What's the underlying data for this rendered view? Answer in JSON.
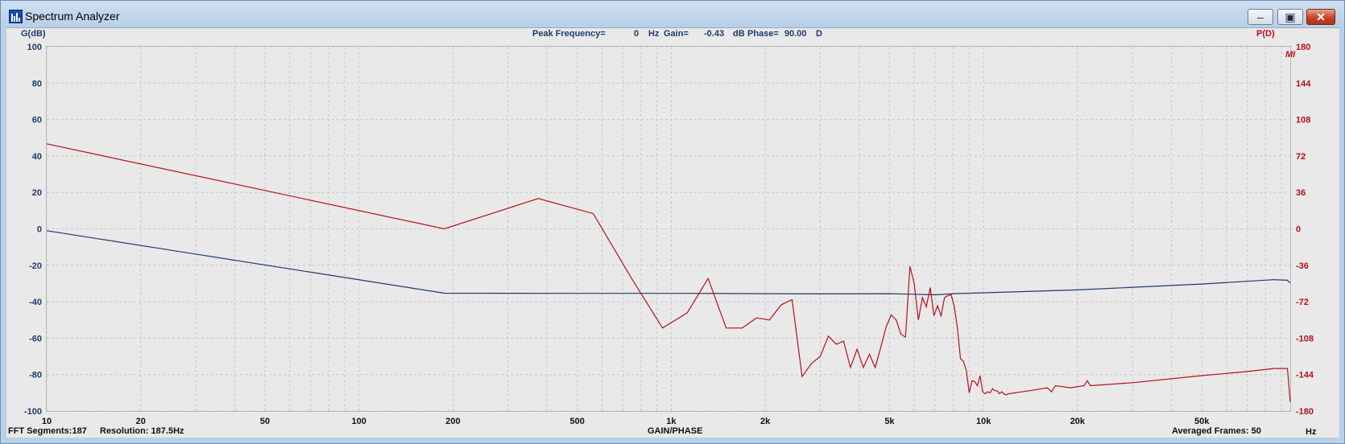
{
  "window": {
    "title": "Spectrum Analyzer",
    "icon": "bar-chart-app-icon",
    "controls": {
      "minimize": "–",
      "maximize": "▣",
      "close": "✕"
    }
  },
  "colors": {
    "gain": "#1d3b6d",
    "phase": "#b3121c",
    "background": "#e9e9e9",
    "grid": "#c8c8c8"
  },
  "readout": {
    "peak_label": "Peak Frequency=",
    "peak_value": "0",
    "peak_unit": "Hz",
    "gain_label": "Gain=",
    "gain_value": "-0.43",
    "gain_unit": "dB",
    "phase_label": "Phase=",
    "phase_value": "90.00",
    "phase_unit": "D"
  },
  "status": {
    "fft_segments": "FFT Segments:187",
    "resolution": "Resolution: 187.5Hz",
    "mode": "GAIN/PHASE",
    "averaged_frames": "Averaged Frames: 50"
  },
  "corner_mark": "MI",
  "chart_data": {
    "type": "line",
    "xscale": "log",
    "xlim": [
      10,
      96000
    ],
    "x_ticks": [
      10,
      20,
      50,
      100,
      200,
      500,
      1000,
      2000,
      5000,
      10000,
      20000,
      50000
    ],
    "x_tick_labels": [
      "10",
      "20",
      "50",
      "100",
      "200",
      "500",
      "1k",
      "2k",
      "5k",
      "10k",
      "20k",
      "50k"
    ],
    "xlabel": "Hz",
    "ylabel_left": "G(dB)",
    "ylim_left": [
      -100,
      100
    ],
    "y_ticks_left": [
      100,
      80,
      60,
      40,
      20,
      0,
      -20,
      -40,
      -60,
      -80,
      -100
    ],
    "ylabel_right": "P(D)",
    "ylim_right": [
      -180,
      180
    ],
    "y_ticks_right": [
      180,
      144,
      108,
      72,
      36,
      0,
      -36,
      -72,
      -108,
      -144,
      -180
    ],
    "grid": true,
    "series": [
      {
        "axis": "left",
        "x": [
          10,
          187.5,
          500,
          1000,
          2000,
          3000,
          5000,
          6000,
          7000,
          8000,
          10000,
          20000,
          50000,
          85000,
          94000,
          96000
        ],
        "values": [
          -1,
          -35.3,
          -35.4,
          -35.4,
          -35.6,
          -35.7,
          -35.6,
          -35.9,
          -36.2,
          -35.6,
          -35.1,
          -33.5,
          -30.3,
          -27.9,
          -28.2,
          -29.8
        ]
      },
      {
        "axis": "right",
        "x": [
          10,
          187.5,
          375,
          562.5,
          750,
          937.5,
          1125,
          1312.5,
          1500,
          1687.5,
          1875,
          2062.5,
          2250,
          2437.5,
          2625,
          2812.5,
          3000,
          3187.5,
          3375,
          3562.5,
          3750,
          3937.5,
          4125,
          4312.5,
          4500,
          4687.5,
          4875,
          5062.5,
          5250,
          5437.5,
          5625,
          5812.5,
          6000,
          6187.5,
          6375,
          6562.5,
          6750,
          6937.5,
          7125,
          7312.5,
          7500,
          7687.5,
          7875,
          8062.5,
          8250,
          8437.5,
          8625,
          8812.5,
          9000,
          9187.5,
          9375,
          9562.5,
          9750,
          9937.5,
          10125,
          10312.5,
          10500,
          10687.5,
          10875,
          11062.5,
          11250,
          11437.5,
          11625,
          11812.5,
          12000,
          14000,
          16000,
          16500,
          17000,
          19000,
          21000,
          21500,
          22000,
          30000,
          50000,
          70000,
          85000,
          94000,
          96000
        ],
        "values": [
          84,
          0,
          30,
          15,
          -50,
          -98,
          -83,
          -49,
          -98,
          -98,
          -88,
          -90,
          -75,
          -70,
          -146,
          -133,
          -126,
          -106,
          -114,
          -111,
          -137,
          -119,
          -137,
          -124,
          -137,
          -117,
          -97,
          -85,
          -90,
          -104,
          -107,
          -37,
          -54,
          -90,
          -68,
          -77,
          -58,
          -86,
          -76,
          -86,
          -68,
          -66,
          -65,
          -77,
          -98,
          -128,
          -131,
          -140,
          -162,
          -150,
          -151,
          -155,
          -145,
          -161,
          -163,
          -161,
          -162,
          -158,
          -160,
          -160,
          -163,
          -161,
          -163,
          -164,
          -163,
          -160,
          -157,
          -161,
          -155,
          -157,
          -155,
          -150,
          -155,
          -152,
          -145,
          -141,
          -138,
          -138,
          -171
        ]
      }
    ]
  }
}
